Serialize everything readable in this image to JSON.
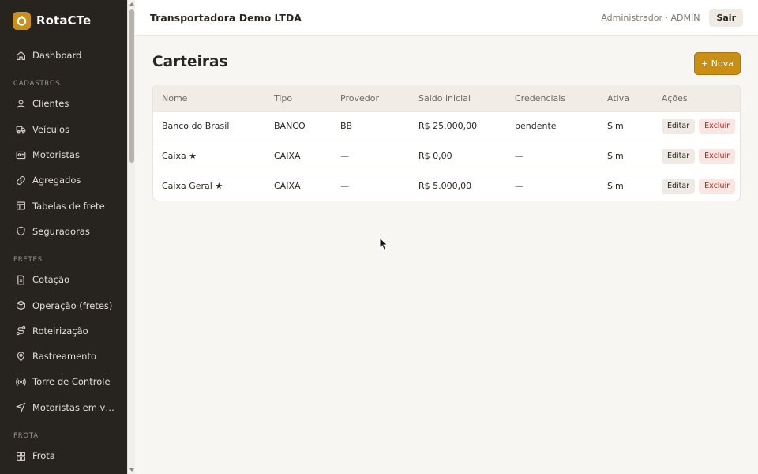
{
  "brand": {
    "name": "RotaCTe",
    "accent": "#c9901b"
  },
  "sidebar": {
    "top": [
      {
        "label": "Dashboard",
        "icon": "home-icon"
      }
    ],
    "sections": [
      {
        "title": "CADASTROS",
        "items": [
          {
            "label": "Clientes",
            "icon": "user-icon"
          },
          {
            "label": "Veículos",
            "icon": "truck-icon"
          },
          {
            "label": "Motoristas",
            "icon": "id-card-icon"
          },
          {
            "label": "Agregados",
            "icon": "link-icon"
          },
          {
            "label": "Tabelas de frete",
            "icon": "table-icon"
          },
          {
            "label": "Seguradoras",
            "icon": "shield-icon"
          }
        ]
      },
      {
        "title": "FRETES",
        "items": [
          {
            "label": "Cotação",
            "icon": "document-icon"
          },
          {
            "label": "Operação (fretes)",
            "icon": "package-icon"
          },
          {
            "label": "Roteirização",
            "icon": "route-icon"
          },
          {
            "label": "Rastreamento",
            "icon": "map-pin-icon"
          },
          {
            "label": "Torre de Controle",
            "icon": "radio-tower-icon"
          },
          {
            "label": "Motoristas em viagem",
            "icon": "navigation-icon"
          }
        ]
      },
      {
        "title": "FROTA",
        "items": [
          {
            "label": "Frota",
            "icon": "grid-icon"
          }
        ]
      }
    ]
  },
  "topbar": {
    "company": "Transportadora Demo LTDA",
    "user": "Administrador · ADMIN",
    "logout_label": "Sair"
  },
  "page": {
    "title": "Carteiras",
    "new_button": "+ Nova"
  },
  "table": {
    "columns": [
      "Nome",
      "Tipo",
      "Provedor",
      "Saldo inicial",
      "Credenciais",
      "Ativa",
      "Ações"
    ],
    "rows": [
      {
        "nome": "Banco do Brasil",
        "tipo": "BANCO",
        "provedor": "BB",
        "saldo": "R$ 25.000,00",
        "credenciais": "pendente",
        "ativa": "Sim"
      },
      {
        "nome": "Caixa ★",
        "tipo": "CAIXA",
        "provedor": "—",
        "saldo": "R$ 0,00",
        "credenciais": "—",
        "ativa": "Sim"
      },
      {
        "nome": "Caixa Geral ★",
        "tipo": "CAIXA",
        "provedor": "—",
        "saldo": "R$ 5.000,00",
        "credenciais": "—",
        "ativa": "Sim"
      }
    ],
    "edit_label": "Editar",
    "delete_label": "Excluir"
  }
}
